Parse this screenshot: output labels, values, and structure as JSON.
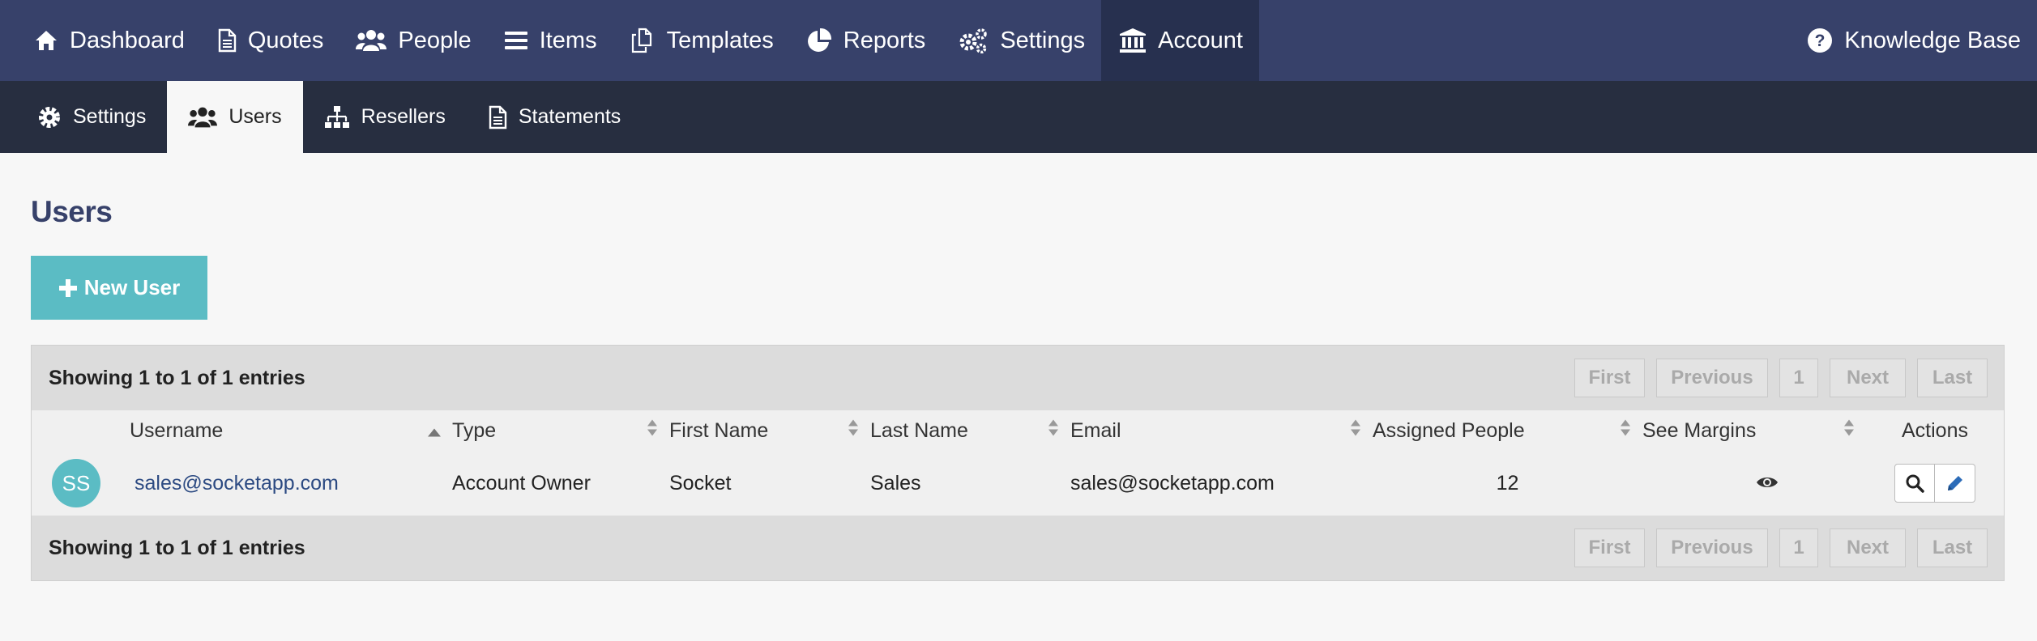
{
  "topnav": {
    "items": [
      {
        "label": "Dashboard",
        "icon": "home-icon"
      },
      {
        "label": "Quotes",
        "icon": "document-icon"
      },
      {
        "label": "People",
        "icon": "people-icon"
      },
      {
        "label": "Items",
        "icon": "list-icon"
      },
      {
        "label": "Templates",
        "icon": "copy-icon"
      },
      {
        "label": "Reports",
        "icon": "pie-chart-icon"
      },
      {
        "label": "Settings",
        "icon": "gears-icon"
      },
      {
        "label": "Account",
        "icon": "bank-icon",
        "active": true
      }
    ],
    "help": {
      "label": "Knowledge Base",
      "icon": "question-circle-icon"
    }
  },
  "subnav": {
    "items": [
      {
        "label": "Settings",
        "icon": "gear-icon"
      },
      {
        "label": "Users",
        "icon": "users-icon",
        "active": true
      },
      {
        "label": "Resellers",
        "icon": "sitemap-icon"
      },
      {
        "label": "Statements",
        "icon": "document-icon"
      }
    ]
  },
  "page": {
    "title": "Users",
    "new_user_label": "New User"
  },
  "table": {
    "info_text": "Showing 1 to 1 of 1 entries",
    "pager": {
      "first": "First",
      "previous": "Previous",
      "page": "1",
      "next": "Next",
      "last": "Last"
    },
    "columns": [
      "Username",
      "Type",
      "First Name",
      "Last Name",
      "Email",
      "Assigned People",
      "See Margins",
      "Actions"
    ],
    "rows": [
      {
        "initials": "SS",
        "username": "sales@socketapp.com",
        "type": "Account Owner",
        "first_name": "Socket",
        "last_name": "Sales",
        "email": "sales@socketapp.com",
        "assigned_people": "12",
        "see_margins_icon": "eye-icon",
        "actions": [
          "search-icon",
          "pencil-icon"
        ]
      }
    ]
  },
  "colors": {
    "topnav_bg": "#37416a",
    "topnav_active_bg": "#27304f",
    "subnav_bg": "#272e40",
    "accent": "#5bbcc4",
    "title": "#37416a",
    "link": "#2c4a82"
  }
}
